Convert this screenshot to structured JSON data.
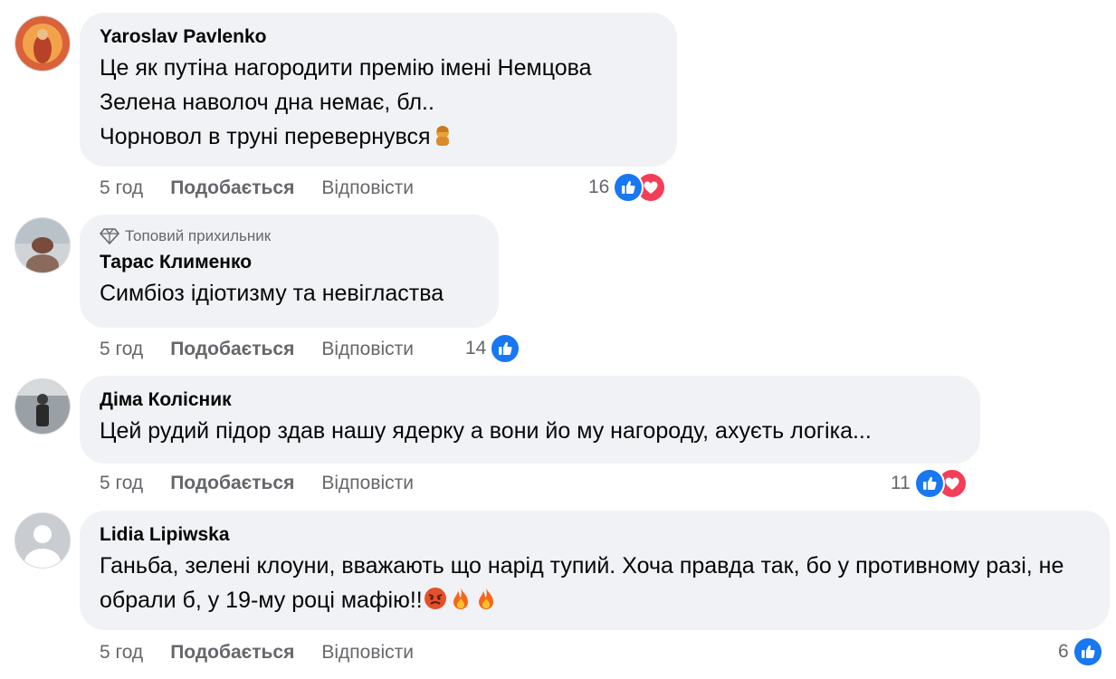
{
  "comments": [
    {
      "author": "Yaroslav Pavlenko",
      "lines": [
        "Це як путіна нагородити премію імені Немцова",
        "Зелена наволоч дна немає, бл..",
        "Чорновол в труні перевернувся"
      ],
      "time": "5 год",
      "like_label": "Подобається",
      "reply_label": "Відповісти",
      "reaction_count": "16",
      "reactions": [
        "like-icon",
        "love-icon"
      ]
    },
    {
      "badge": "Топовий прихильник",
      "author": "Тарас Клименко",
      "lines": [
        "Симбіоз ідіотизму та невігластва"
      ],
      "time": "5 год",
      "like_label": "Подобається",
      "reply_label": "Відповісти",
      "reaction_count": "14",
      "reactions": [
        "like-icon"
      ]
    },
    {
      "author": "Діма Колісник",
      "lines": [
        "Цей рудий підор здав нашу ядерку а вони йо му нагороду, ахуєть логіка..."
      ],
      "time": "5 год",
      "like_label": "Подобається",
      "reply_label": "Відповісти",
      "reaction_count": "11",
      "reactions": [
        "like-icon",
        "love-icon"
      ]
    },
    {
      "author": "Lidia Lipiwska",
      "lines": [
        "Ганьба, зелені клоуни, вважають що нарід тупий. Хоча правда так, бо у противному разі, не обрали б, у 19-му році мафію!!"
      ],
      "time": "5 год",
      "like_label": "Подобається",
      "reply_label": "Відповісти",
      "reaction_count": "6",
      "reactions": [
        "like-icon"
      ]
    }
  ],
  "colors": {
    "bubble": "#f0f2f5",
    "like_blue": "#1877f2",
    "love_red": "#f33e58",
    "meta_gray": "#65676b"
  }
}
